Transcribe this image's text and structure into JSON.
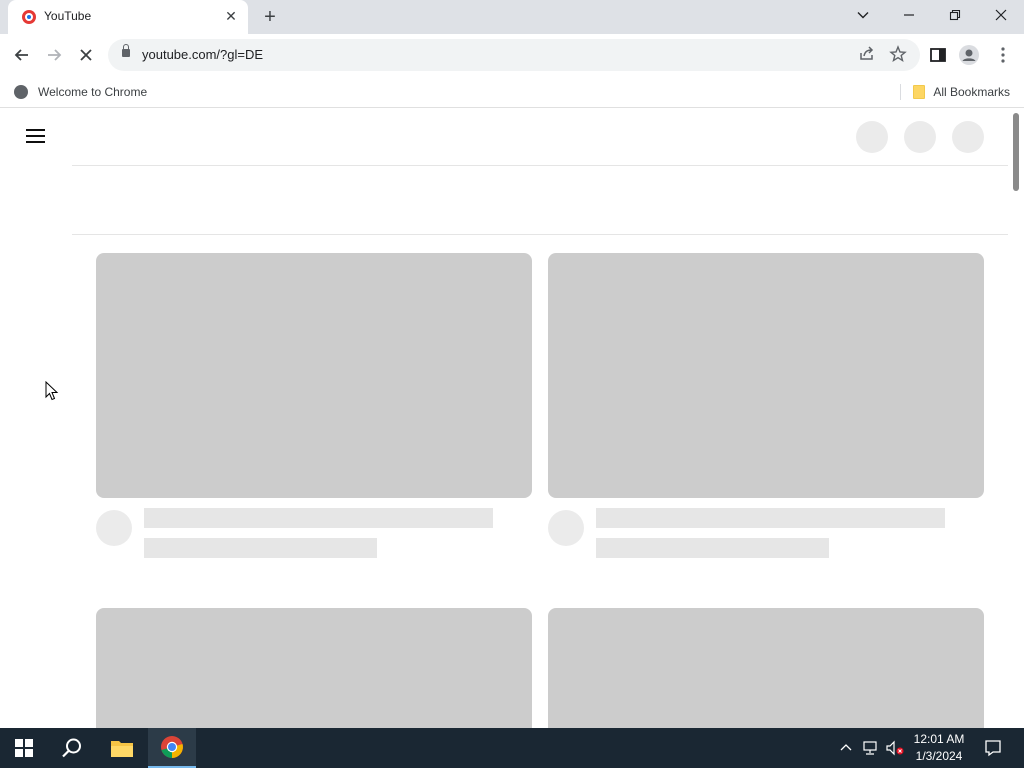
{
  "browser": {
    "tab_title": "YouTube",
    "tab_close": "✕",
    "new_tab": "+",
    "url": "youtube.com/?gl=DE",
    "bookmark_welcome": "Welcome to Chrome",
    "bookmark_all": "All Bookmarks"
  },
  "taskbar": {
    "time": "12:01 AM",
    "date": "1/3/2024"
  },
  "colors": {
    "skeleton": "#cccccc",
    "taskbar": "#1a2733"
  }
}
